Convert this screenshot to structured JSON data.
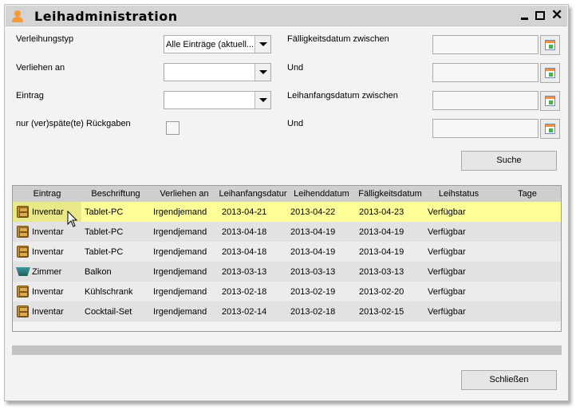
{
  "window": {
    "title": "Leihadministration",
    "icon": "user-icon",
    "controls": [
      "minimize-icon",
      "maximize-icon",
      "close-icon"
    ]
  },
  "filters": {
    "verleihungstyp": {
      "label": "Verleihungstyp",
      "value": "Alle Einträge (aktuell..."
    },
    "verliehen_an": {
      "label": "Verliehen an",
      "value": ""
    },
    "eintrag": {
      "label": "Eintrag",
      "value": ""
    },
    "verspaetet": {
      "label": "nur (ver)späte(te) Rückgaben",
      "checked": false
    },
    "faellig_von": {
      "label": "Fälligkeitsdatum zwischen",
      "value": ""
    },
    "faellig_bis": {
      "label": "Und",
      "value": ""
    },
    "anfang_von": {
      "label": "Leihanfangsdatum zwischen",
      "value": ""
    },
    "anfang_bis": {
      "label": "Und",
      "value": ""
    },
    "search_label": "Suche"
  },
  "table": {
    "columns": [
      "Eintrag",
      "Beschriftung",
      "Verliehen an",
      "Leihanfangsdatur",
      "Leihenddatum",
      "Fälligkeitsdatum",
      "Leihstatus",
      "Tage"
    ],
    "rows": [
      [
        "Inventar",
        "Tablet-PC",
        "Irgendjemand",
        "2013-04-21",
        "2013-04-22",
        "2013-04-23",
        "Verfügbar",
        ""
      ],
      [
        "Inventar",
        "Tablet-PC",
        "Irgendjemand",
        "2013-04-18",
        "2013-04-19",
        "2013-04-19",
        "Verfügbar",
        ""
      ],
      [
        "Inventar",
        "Tablet-PC",
        "Irgendjemand",
        "2013-04-18",
        "2013-04-19",
        "2013-04-19",
        "Verfügbar",
        ""
      ],
      [
        "Zimmer",
        "Balkon",
        "Irgendjemand",
        "2013-03-13",
        "2013-03-13",
        "2013-03-13",
        "Verfügbar",
        ""
      ],
      [
        "Inventar",
        "Kühlschrank",
        "Irgendjemand",
        "2013-02-18",
        "2013-02-19",
        "2013-02-20",
        "Verfügbar",
        ""
      ],
      [
        "Inventar",
        "Cocktail-Set",
        "Irgendjemand",
        "2013-02-14",
        "2013-02-18",
        "2013-02-15",
        "Verfügbar",
        ""
      ]
    ],
    "selected_row": 0,
    "colors": {
      "selected": "#ffff99",
      "row_a": "#e2e2e2",
      "row_b": "#ececec"
    }
  },
  "close_label": "Schließen"
}
